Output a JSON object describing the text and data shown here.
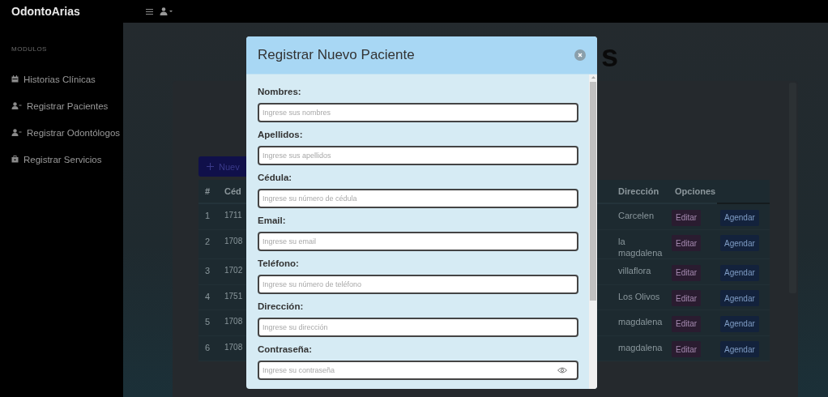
{
  "topbar": {
    "brand": "OdontoArias"
  },
  "sidebar": {
    "section": "MODULOS",
    "items": [
      {
        "label": "Historias Clínicas",
        "kind": "calendar"
      },
      {
        "label": "Registrar Pacientes",
        "kind": "user-add"
      },
      {
        "label": "Registrar Odontólogos",
        "kind": "user-add"
      },
      {
        "label": "Registrar Servicios",
        "kind": "case"
      }
    ]
  },
  "page": {
    "heading_fragment": "s",
    "new_button": "Nuev",
    "table": {
      "columns": [
        "#",
        "Céd",
        "Dirección",
        "Opciones"
      ],
      "rows": [
        {
          "number": "1",
          "cedula": "1711",
          "direccion": "Carcelen",
          "edit": "Editar",
          "schedule": "Agendar"
        },
        {
          "number": "2",
          "cedula": "1708",
          "direccion": "la magdalena",
          "edit": "Editar",
          "schedule": "Agendar"
        },
        {
          "number": "3",
          "cedula": "1702",
          "direccion": "villaflora",
          "edit": "Editar",
          "schedule": "Agendar"
        },
        {
          "number": "4",
          "cedula": "1751",
          "direccion": "Los Olivos",
          "edit": "Editar",
          "schedule": "Agendar"
        },
        {
          "number": "5",
          "cedula": "1708",
          "direccion": "magdalena",
          "edit": "Editar",
          "schedule": "Agendar"
        },
        {
          "number": "6",
          "cedula": "1708",
          "direccion": "magdalena",
          "edit": "Editar",
          "schedule": "Agendar"
        }
      ]
    }
  },
  "modal": {
    "title": "Registrar Nuevo Paciente",
    "fields": [
      {
        "label": "Nombres:",
        "placeholder": "Ingrese sus nombres",
        "kind": "text"
      },
      {
        "label": "Apellidos:",
        "placeholder": "Ingrese sus apellidos",
        "kind": "text"
      },
      {
        "label": "Cédula:",
        "placeholder": "Ingrese su número de cédula",
        "kind": "text"
      },
      {
        "label": "Email:",
        "placeholder": "Ingrese su email",
        "kind": "text"
      },
      {
        "label": "Teléfono:",
        "placeholder": "Ingrese su número de teléfono",
        "kind": "text"
      },
      {
        "label": "Dirección:",
        "placeholder": "Ingrese su dirección",
        "kind": "text"
      },
      {
        "label": "Contraseña:",
        "placeholder": "Ingrese su contraseña",
        "kind": "password"
      }
    ]
  }
}
